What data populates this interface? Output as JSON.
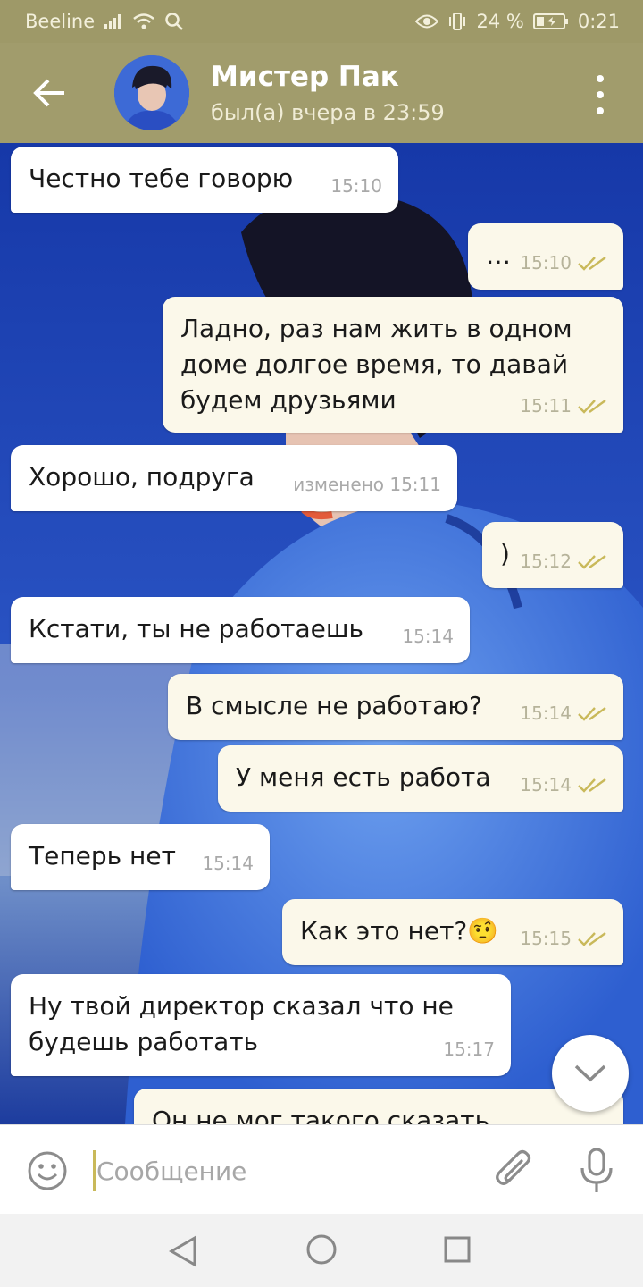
{
  "status_bar": {
    "carrier": "Beeline",
    "battery": "24 %",
    "time": "0:21"
  },
  "header": {
    "contact_name": "Мистер Пак",
    "last_seen": "был(а) вчера в 23:59",
    "back_icon": "arrow-left-icon",
    "menu_icon": "more-vertical-icon"
  },
  "messages": [
    {
      "side": "in",
      "text": "Честно тебе говорю",
      "time": "15:10"
    },
    {
      "side": "out",
      "text": "…",
      "time": "15:10",
      "read": true
    },
    {
      "side": "out",
      "text": "Ладно, раз нам жить в одном доме долгое время, то давай будем друзьями",
      "time": "15:11",
      "read": true
    },
    {
      "side": "in",
      "text": "Хорошо, подруга",
      "time": "изменено 15:11"
    },
    {
      "side": "out",
      "text": ")",
      "time": "15:12",
      "read": true
    },
    {
      "side": "in",
      "text": "Кстати, ты не работаешь",
      "time": "15:14"
    },
    {
      "side": "out",
      "text": "В смысле не работаю?",
      "time": "15:14",
      "read": true
    },
    {
      "side": "out",
      "text": "У меня есть работа",
      "time": "15:14",
      "read": true
    },
    {
      "side": "in",
      "text": "Теперь нет",
      "time": "15:14"
    },
    {
      "side": "out",
      "text": "Как это нет?",
      "emoji": "🤨",
      "time": "15:15",
      "read": true
    },
    {
      "side": "in",
      "text": "Ну твой директор сказал что не будешь работать",
      "time": "15:17"
    },
    {
      "side": "out",
      "text": "Он не мог такого сказать",
      "time": "",
      "read": true
    }
  ],
  "composer": {
    "placeholder": "Сообщение",
    "emoji_icon": "smiley-icon",
    "attach_icon": "paperclip-icon",
    "mic_icon": "microphone-icon"
  },
  "scroll_down_icon": "chevron-down-icon",
  "colors": {
    "header": "#a19c6c",
    "status_bar": "#9e9968",
    "incoming_bubble": "#ffffff",
    "outgoing_bubble": "#fbf8ea",
    "read_ticks": "#c9b95a",
    "wallpaper": "#1e3fae"
  }
}
